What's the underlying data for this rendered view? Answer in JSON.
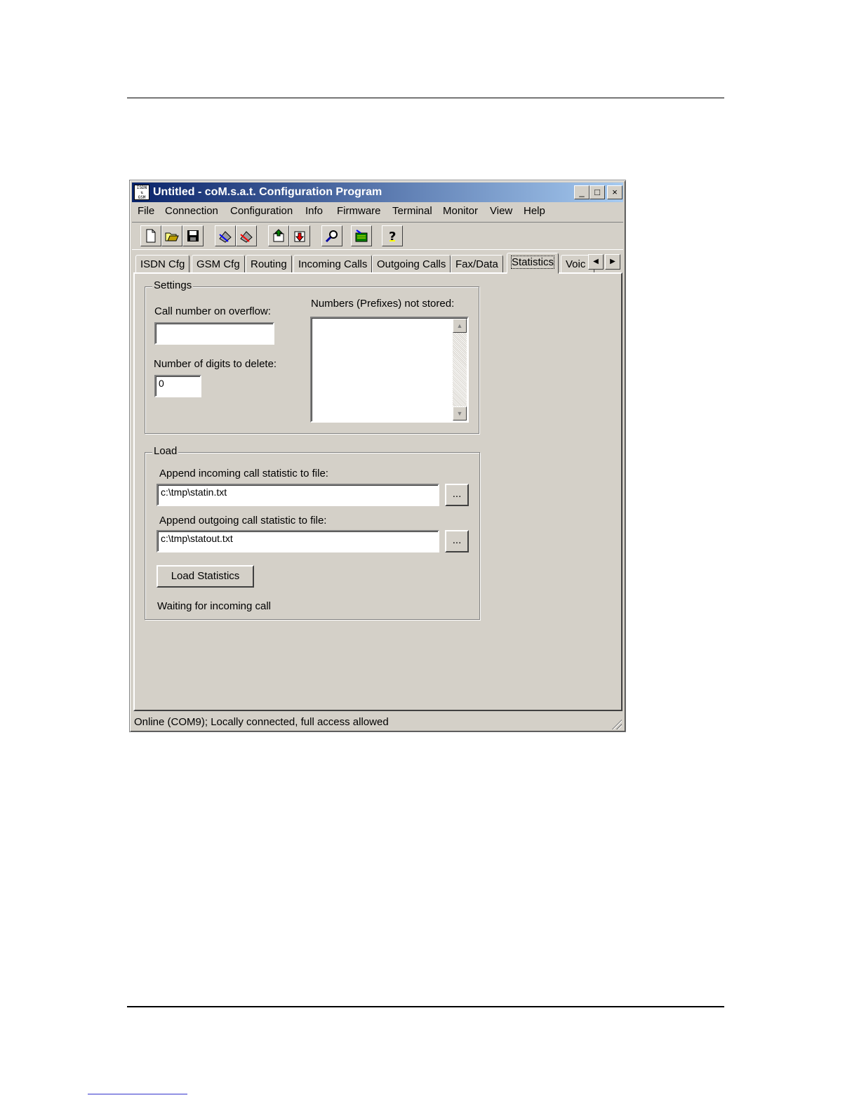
{
  "window": {
    "title": "Untitled - coM.s.a.t. Configuration Program",
    "icon_text": "ISDN\nGSM",
    "controls": [
      "_",
      "□",
      "×"
    ]
  },
  "menu": [
    {
      "label": "File"
    },
    {
      "label": "Connection"
    },
    {
      "label": "Configuration"
    },
    {
      "label": "Info"
    },
    {
      "label": "Firmware"
    },
    {
      "label": "Terminal"
    },
    {
      "label": "Monitor"
    },
    {
      "label": "View"
    },
    {
      "label": "Help"
    }
  ],
  "toolbar": [
    "new-icon",
    "open-icon",
    "save-icon",
    "connect-icon",
    "disconnect-icon",
    "upload-icon",
    "download-icon",
    "search-icon",
    "monitor-icon",
    "help-icon"
  ],
  "tabs": [
    {
      "label": "ISDN Cfg"
    },
    {
      "label": "GSM Cfg"
    },
    {
      "label": "Routing"
    },
    {
      "label": "Incoming Calls"
    },
    {
      "label": "Outgoing Calls"
    },
    {
      "label": "Fax/Data"
    },
    {
      "label": "Statistics"
    },
    {
      "label": "Voic"
    }
  ],
  "tab_scroll": {
    "left": "◀",
    "right": "▶"
  },
  "settings": {
    "group_label": "Settings",
    "overflow_label": "Call number on overflow:",
    "overflow_value": "",
    "digits_label": "Number of digits to delete:",
    "digits_value": "0",
    "prefixes_label": "Numbers (Prefixes) not stored:",
    "scroll_up": "▲",
    "scroll_down": "▼"
  },
  "load": {
    "group_label": "Load",
    "incoming_label": "Append incoming call statistic to file:",
    "incoming_value": "c:\\tmp\\statin.txt",
    "outgoing_label": "Append outgoing call statistic to file:",
    "outgoing_value": "c:\\tmp\\statout.txt",
    "browse_label": "...",
    "load_button": "Load Statistics",
    "status": "Waiting for incoming call"
  },
  "statusbar": {
    "text": "Online (COM9); Locally connected, full access allowed"
  }
}
